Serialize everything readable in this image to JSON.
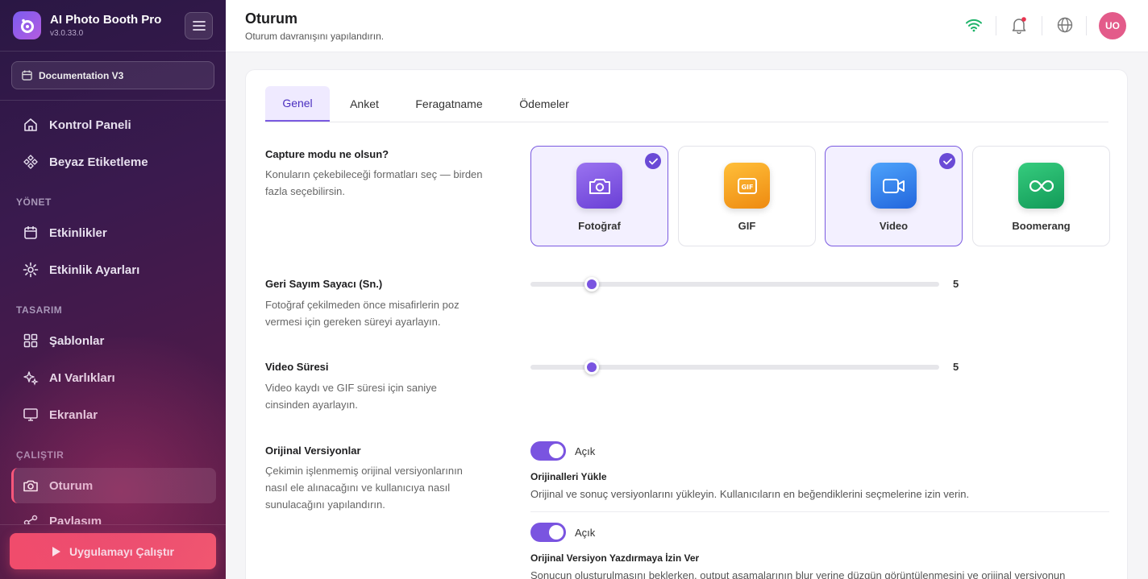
{
  "app": {
    "name": "AI Photo Booth Pro",
    "version": "v3.0.33.0"
  },
  "project": {
    "label": "Documentation V3"
  },
  "nav": {
    "dashboard": "Kontrol Paneli",
    "white_label": "Beyaz Etiketleme",
    "section_manage": "YÖNET",
    "events": "Etkinlikler",
    "event_settings": "Etkinlik Ayarları",
    "section_design": "TASARIM",
    "templates": "Şablonlar",
    "ai_assets": "AI Varlıkları",
    "screens": "Ekranlar",
    "section_run": "ÇALIŞTIR",
    "session": "Oturum",
    "sharing": "Paylaşım"
  },
  "run_button": "Uygulamayı Çalıştır",
  "header": {
    "title": "Oturum",
    "subtitle": "Oturum davranışını yapılandırın.",
    "avatar_initials": "UO",
    "icons": [
      "wifi-icon",
      "bell-icon",
      "globe-icon"
    ]
  },
  "tabs": [
    "Genel",
    "Anket",
    "Feragatname",
    "Ödemeler"
  ],
  "active_tab": "Genel",
  "capture": {
    "title": "Capture modu ne olsun?",
    "desc": "Konuların çekebileceği formatları seç — birden fazla seçebilirsin.",
    "modes": [
      {
        "label": "Fotoğraf",
        "selected": true,
        "color": "#7b4fe0",
        "icon": "camera-icon"
      },
      {
        "label": "GIF",
        "selected": false,
        "color": "#f09a1a",
        "icon": "gif-icon"
      },
      {
        "label": "Video",
        "selected": true,
        "color": "#2f7de8",
        "icon": "video-icon"
      },
      {
        "label": "Boomerang",
        "selected": false,
        "color": "#1faa63",
        "icon": "infinity-icon"
      }
    ]
  },
  "countdown": {
    "title": "Geri Sayım Sayacı (Sn.)",
    "desc": "Fotoğraf çekilmeden önce misafirlerin poz vermesi için gereken süreyi ayarlayın.",
    "value": "5",
    "fraction": 0.15
  },
  "video_duration": {
    "title": "Video Süresi",
    "desc": "Video kaydı ve GIF süresi için saniye cinsinden ayarlayın.",
    "value": "5",
    "fraction": 0.15
  },
  "originals": {
    "title": "Orijinal Versiyonlar",
    "desc": "Çekimin işlenmemiş orijinal versiyonlarının nasıl ele alınacağını ve kullanıcıya nasıl sunulacağını yapılandırın.",
    "options": [
      {
        "toggle_label": "Açık",
        "title": "Orijinalleri Yükle",
        "desc": "Orijinal ve sonuç versiyonlarını yükleyin. Kullanıcıların en beğendiklerini seçmelerine izin verin."
      },
      {
        "toggle_label": "Açık",
        "title": "Orijinal Versiyon Yazdırmaya İzin Ver",
        "desc": "Sonucun oluşturulmasını beklerken, output aşamalarının blur yerine düzgün görüntülenmesini ve orijinal versiyonun"
      }
    ]
  }
}
